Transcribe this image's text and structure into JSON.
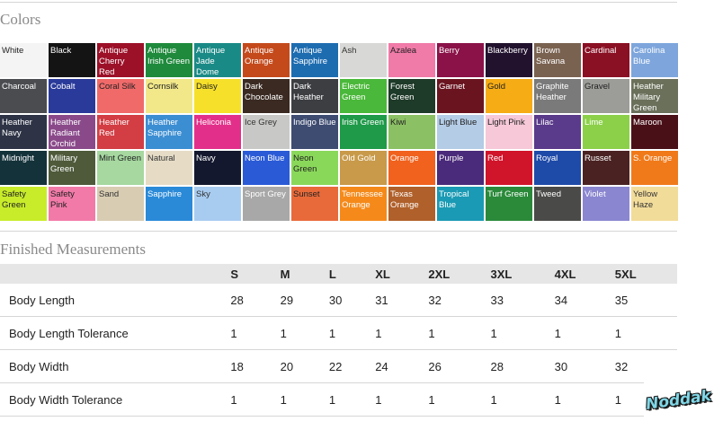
{
  "colors_section": {
    "title": "Colors",
    "swatches": [
      {
        "name": "White",
        "color": "#f4f4f4",
        "text": "#222222"
      },
      {
        "name": "Black",
        "color": "#141414",
        "text": "#ffffff"
      },
      {
        "name": "Antique Cherry Red",
        "color": "#9c1028",
        "text": "#ffffff"
      },
      {
        "name": "Antique Irish Green",
        "color": "#1f8a3c",
        "text": "#ffffff"
      },
      {
        "name": "Antique Jade Dome",
        "color": "#1a8a86",
        "text": "#ffffff"
      },
      {
        "name": "Antique Orange",
        "color": "#c44a1c",
        "text": "#ffffff"
      },
      {
        "name": "Antique Sapphire",
        "color": "#1e6cb0",
        "text": "#ffffff"
      },
      {
        "name": "Ash",
        "color": "#d8d8d6",
        "text": "#333333"
      },
      {
        "name": "Azalea",
        "color": "#f07aa8",
        "text": "#222222"
      },
      {
        "name": "Berry",
        "color": "#8a1248",
        "text": "#ffffff"
      },
      {
        "name": "Blackberry",
        "color": "#22122e",
        "text": "#ffffff"
      },
      {
        "name": "Brown Savana",
        "color": "#7a6250",
        "text": "#ffffff"
      },
      {
        "name": "Cardinal",
        "color": "#8a1024",
        "text": "#ffffff"
      },
      {
        "name": "Carolina Blue",
        "color": "#7ea6dc",
        "text": "#ffffff"
      },
      {
        "name": "Charcoal",
        "color": "#4a4c50",
        "text": "#ffffff"
      },
      {
        "name": "Cobalt",
        "color": "#2a3a9a",
        "text": "#ffffff"
      },
      {
        "name": "Coral Silk",
        "color": "#f06a6a",
        "text": "#222222"
      },
      {
        "name": "Cornsilk",
        "color": "#f2e88a",
        "text": "#222222"
      },
      {
        "name": "Daisy",
        "color": "#f7e02a",
        "text": "#222222"
      },
      {
        "name": "Dark Chocolate",
        "color": "#3a2a22",
        "text": "#ffffff"
      },
      {
        "name": "Dark Heather",
        "color": "#3c3e42",
        "text": "#ffffff"
      },
      {
        "name": "Electric Green",
        "color": "#4ab83a",
        "text": "#ffffff"
      },
      {
        "name": "Forest Green",
        "color": "#1e3a28",
        "text": "#ffffff"
      },
      {
        "name": "Garnet",
        "color": "#6a1420",
        "text": "#ffffff"
      },
      {
        "name": "Gold",
        "color": "#f6ac14",
        "text": "#222222"
      },
      {
        "name": "Graphite Heather",
        "color": "#7a7a7a",
        "text": "#ffffff"
      },
      {
        "name": "Gravel",
        "color": "#9c9c98",
        "text": "#222222"
      },
      {
        "name": "Heather Military Green",
        "color": "#6a705a",
        "text": "#ffffff"
      },
      {
        "name": "Heather Navy",
        "color": "#2e3446",
        "text": "#ffffff"
      },
      {
        "name": "Heather Radiant Orchid",
        "color": "#8a4a8a",
        "text": "#ffffff"
      },
      {
        "name": "Heather Red",
        "color": "#d23e44",
        "text": "#ffffff"
      },
      {
        "name": "Heather Sapphire",
        "color": "#3c8ed2",
        "text": "#ffffff"
      },
      {
        "name": "Heliconia",
        "color": "#e2308a",
        "text": "#ffffff"
      },
      {
        "name": "Ice Grey",
        "color": "#c8c8c6",
        "text": "#333333"
      },
      {
        "name": "Indigo Blue",
        "color": "#3e4c72",
        "text": "#ffffff"
      },
      {
        "name": "Irish Green",
        "color": "#1e9a48",
        "text": "#ffffff"
      },
      {
        "name": "Kiwi",
        "color": "#8cc064",
        "text": "#222222"
      },
      {
        "name": "Light Blue",
        "color": "#b4cce6",
        "text": "#222222"
      },
      {
        "name": "Light Pink",
        "color": "#f6c8d8",
        "text": "#222222"
      },
      {
        "name": "Lilac",
        "color": "#5a3a8a",
        "text": "#ffffff"
      },
      {
        "name": "Lime",
        "color": "#8cd04a",
        "text": "#ffffff"
      },
      {
        "name": "Maroon",
        "color": "#4a1018",
        "text": "#ffffff"
      },
      {
        "name": "Midnight",
        "color": "#14323a",
        "text": "#ffffff"
      },
      {
        "name": "Military Green",
        "color": "#4e5a3a",
        "text": "#ffffff"
      },
      {
        "name": "Mint Green",
        "color": "#a6d8a0",
        "text": "#222222"
      },
      {
        "name": "Natural",
        "color": "#e6dcc6",
        "text": "#333333"
      },
      {
        "name": "Navy",
        "color": "#14182e",
        "text": "#ffffff"
      },
      {
        "name": "Neon Blue",
        "color": "#2a5ad6",
        "text": "#ffffff"
      },
      {
        "name": "Neon Green",
        "color": "#8ad85a",
        "text": "#222222"
      },
      {
        "name": "Old Gold",
        "color": "#c89a4a",
        "text": "#ffffff"
      },
      {
        "name": "Orange",
        "color": "#f0621e",
        "text": "#ffffff"
      },
      {
        "name": "Purple",
        "color": "#4a2a7a",
        "text": "#ffffff"
      },
      {
        "name": "Red",
        "color": "#d0142a",
        "text": "#ffffff"
      },
      {
        "name": "Royal",
        "color": "#1e4aa8",
        "text": "#ffffff"
      },
      {
        "name": "Russet",
        "color": "#4a2222",
        "text": "#ffffff"
      },
      {
        "name": "S. Orange",
        "color": "#f07a1a",
        "text": "#ffffff"
      },
      {
        "name": "Safety Green",
        "color": "#c8ec2a",
        "text": "#222222"
      },
      {
        "name": "Safety Pink",
        "color": "#f27aa8",
        "text": "#222222"
      },
      {
        "name": "Sand",
        "color": "#d8ccb2",
        "text": "#333333"
      },
      {
        "name": "Sapphire",
        "color": "#2a8ad8",
        "text": "#ffffff"
      },
      {
        "name": "Sky",
        "color": "#a8ccf0",
        "text": "#333333"
      },
      {
        "name": "Sport Grey",
        "color": "#a8a8a8",
        "text": "#ffffff"
      },
      {
        "name": "Sunset",
        "color": "#e86a3a",
        "text": "#222222"
      },
      {
        "name": "Tennessee Orange",
        "color": "#f58a1a",
        "text": "#ffffff"
      },
      {
        "name": "Texas Orange",
        "color": "#b0602a",
        "text": "#ffffff"
      },
      {
        "name": "Tropical Blue",
        "color": "#1a9ab4",
        "text": "#ffffff"
      },
      {
        "name": "Turf Green",
        "color": "#2a8a3a",
        "text": "#ffffff"
      },
      {
        "name": "Tweed",
        "color": "#4a4a48",
        "text": "#ffffff"
      },
      {
        "name": "Violet",
        "color": "#8a86d0",
        "text": "#ffffff"
      },
      {
        "name": "Yellow Haze",
        "color": "#f2dc9a",
        "text": "#333333"
      }
    ]
  },
  "measurements_section": {
    "title": "Finished Measurements",
    "sizes": [
      "S",
      "M",
      "L",
      "XL",
      "2XL",
      "3XL",
      "4XL",
      "5XL"
    ],
    "rows": [
      {
        "label": "Body Length",
        "values": [
          "28",
          "29",
          "30",
          "31",
          "32",
          "33",
          "34",
          "35"
        ]
      },
      {
        "label": "Body Length Tolerance",
        "values": [
          "1",
          "1",
          "1",
          "1",
          "1",
          "1",
          "1",
          "1"
        ]
      },
      {
        "label": "Body Width",
        "values": [
          "18",
          "20",
          "22",
          "24",
          "26",
          "28",
          "30",
          "32"
        ]
      },
      {
        "label": "Body Width Tolerance",
        "values": [
          "1",
          "1",
          "1",
          "1",
          "1",
          "1",
          "1",
          "1"
        ]
      }
    ]
  },
  "logo": {
    "text": "Noddak"
  }
}
